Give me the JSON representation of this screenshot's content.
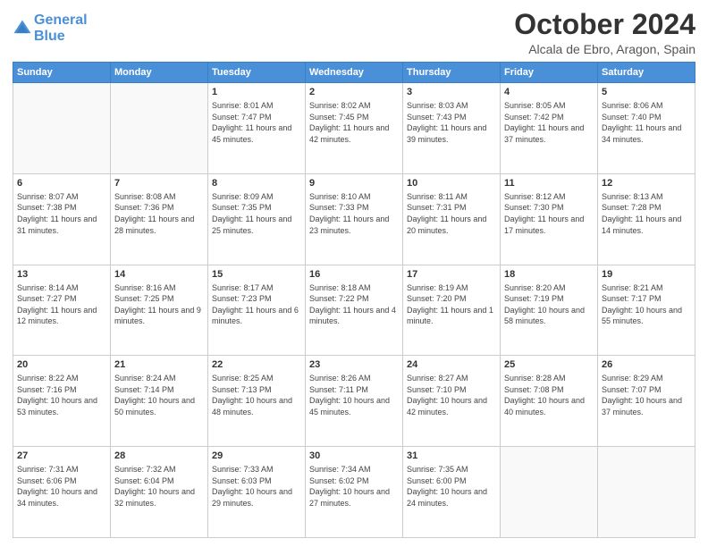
{
  "header": {
    "logo_line1": "General",
    "logo_line2": "Blue",
    "month": "October 2024",
    "location": "Alcala de Ebro, Aragon, Spain"
  },
  "weekdays": [
    "Sunday",
    "Monday",
    "Tuesday",
    "Wednesday",
    "Thursday",
    "Friday",
    "Saturday"
  ],
  "weeks": [
    [
      {
        "day": "",
        "info": ""
      },
      {
        "day": "",
        "info": ""
      },
      {
        "day": "1",
        "info": "Sunrise: 8:01 AM\nSunset: 7:47 PM\nDaylight: 11 hours and 45 minutes."
      },
      {
        "day": "2",
        "info": "Sunrise: 8:02 AM\nSunset: 7:45 PM\nDaylight: 11 hours and 42 minutes."
      },
      {
        "day": "3",
        "info": "Sunrise: 8:03 AM\nSunset: 7:43 PM\nDaylight: 11 hours and 39 minutes."
      },
      {
        "day": "4",
        "info": "Sunrise: 8:05 AM\nSunset: 7:42 PM\nDaylight: 11 hours and 37 minutes."
      },
      {
        "day": "5",
        "info": "Sunrise: 8:06 AM\nSunset: 7:40 PM\nDaylight: 11 hours and 34 minutes."
      }
    ],
    [
      {
        "day": "6",
        "info": "Sunrise: 8:07 AM\nSunset: 7:38 PM\nDaylight: 11 hours and 31 minutes."
      },
      {
        "day": "7",
        "info": "Sunrise: 8:08 AM\nSunset: 7:36 PM\nDaylight: 11 hours and 28 minutes."
      },
      {
        "day": "8",
        "info": "Sunrise: 8:09 AM\nSunset: 7:35 PM\nDaylight: 11 hours and 25 minutes."
      },
      {
        "day": "9",
        "info": "Sunrise: 8:10 AM\nSunset: 7:33 PM\nDaylight: 11 hours and 23 minutes."
      },
      {
        "day": "10",
        "info": "Sunrise: 8:11 AM\nSunset: 7:31 PM\nDaylight: 11 hours and 20 minutes."
      },
      {
        "day": "11",
        "info": "Sunrise: 8:12 AM\nSunset: 7:30 PM\nDaylight: 11 hours and 17 minutes."
      },
      {
        "day": "12",
        "info": "Sunrise: 8:13 AM\nSunset: 7:28 PM\nDaylight: 11 hours and 14 minutes."
      }
    ],
    [
      {
        "day": "13",
        "info": "Sunrise: 8:14 AM\nSunset: 7:27 PM\nDaylight: 11 hours and 12 minutes."
      },
      {
        "day": "14",
        "info": "Sunrise: 8:16 AM\nSunset: 7:25 PM\nDaylight: 11 hours and 9 minutes."
      },
      {
        "day": "15",
        "info": "Sunrise: 8:17 AM\nSunset: 7:23 PM\nDaylight: 11 hours and 6 minutes."
      },
      {
        "day": "16",
        "info": "Sunrise: 8:18 AM\nSunset: 7:22 PM\nDaylight: 11 hours and 4 minutes."
      },
      {
        "day": "17",
        "info": "Sunrise: 8:19 AM\nSunset: 7:20 PM\nDaylight: 11 hours and 1 minute."
      },
      {
        "day": "18",
        "info": "Sunrise: 8:20 AM\nSunset: 7:19 PM\nDaylight: 10 hours and 58 minutes."
      },
      {
        "day": "19",
        "info": "Sunrise: 8:21 AM\nSunset: 7:17 PM\nDaylight: 10 hours and 55 minutes."
      }
    ],
    [
      {
        "day": "20",
        "info": "Sunrise: 8:22 AM\nSunset: 7:16 PM\nDaylight: 10 hours and 53 minutes."
      },
      {
        "day": "21",
        "info": "Sunrise: 8:24 AM\nSunset: 7:14 PM\nDaylight: 10 hours and 50 minutes."
      },
      {
        "day": "22",
        "info": "Sunrise: 8:25 AM\nSunset: 7:13 PM\nDaylight: 10 hours and 48 minutes."
      },
      {
        "day": "23",
        "info": "Sunrise: 8:26 AM\nSunset: 7:11 PM\nDaylight: 10 hours and 45 minutes."
      },
      {
        "day": "24",
        "info": "Sunrise: 8:27 AM\nSunset: 7:10 PM\nDaylight: 10 hours and 42 minutes."
      },
      {
        "day": "25",
        "info": "Sunrise: 8:28 AM\nSunset: 7:08 PM\nDaylight: 10 hours and 40 minutes."
      },
      {
        "day": "26",
        "info": "Sunrise: 8:29 AM\nSunset: 7:07 PM\nDaylight: 10 hours and 37 minutes."
      }
    ],
    [
      {
        "day": "27",
        "info": "Sunrise: 7:31 AM\nSunset: 6:06 PM\nDaylight: 10 hours and 34 minutes."
      },
      {
        "day": "28",
        "info": "Sunrise: 7:32 AM\nSunset: 6:04 PM\nDaylight: 10 hours and 32 minutes."
      },
      {
        "day": "29",
        "info": "Sunrise: 7:33 AM\nSunset: 6:03 PM\nDaylight: 10 hours and 29 minutes."
      },
      {
        "day": "30",
        "info": "Sunrise: 7:34 AM\nSunset: 6:02 PM\nDaylight: 10 hours and 27 minutes."
      },
      {
        "day": "31",
        "info": "Sunrise: 7:35 AM\nSunset: 6:00 PM\nDaylight: 10 hours and 24 minutes."
      },
      {
        "day": "",
        "info": ""
      },
      {
        "day": "",
        "info": ""
      }
    ]
  ]
}
